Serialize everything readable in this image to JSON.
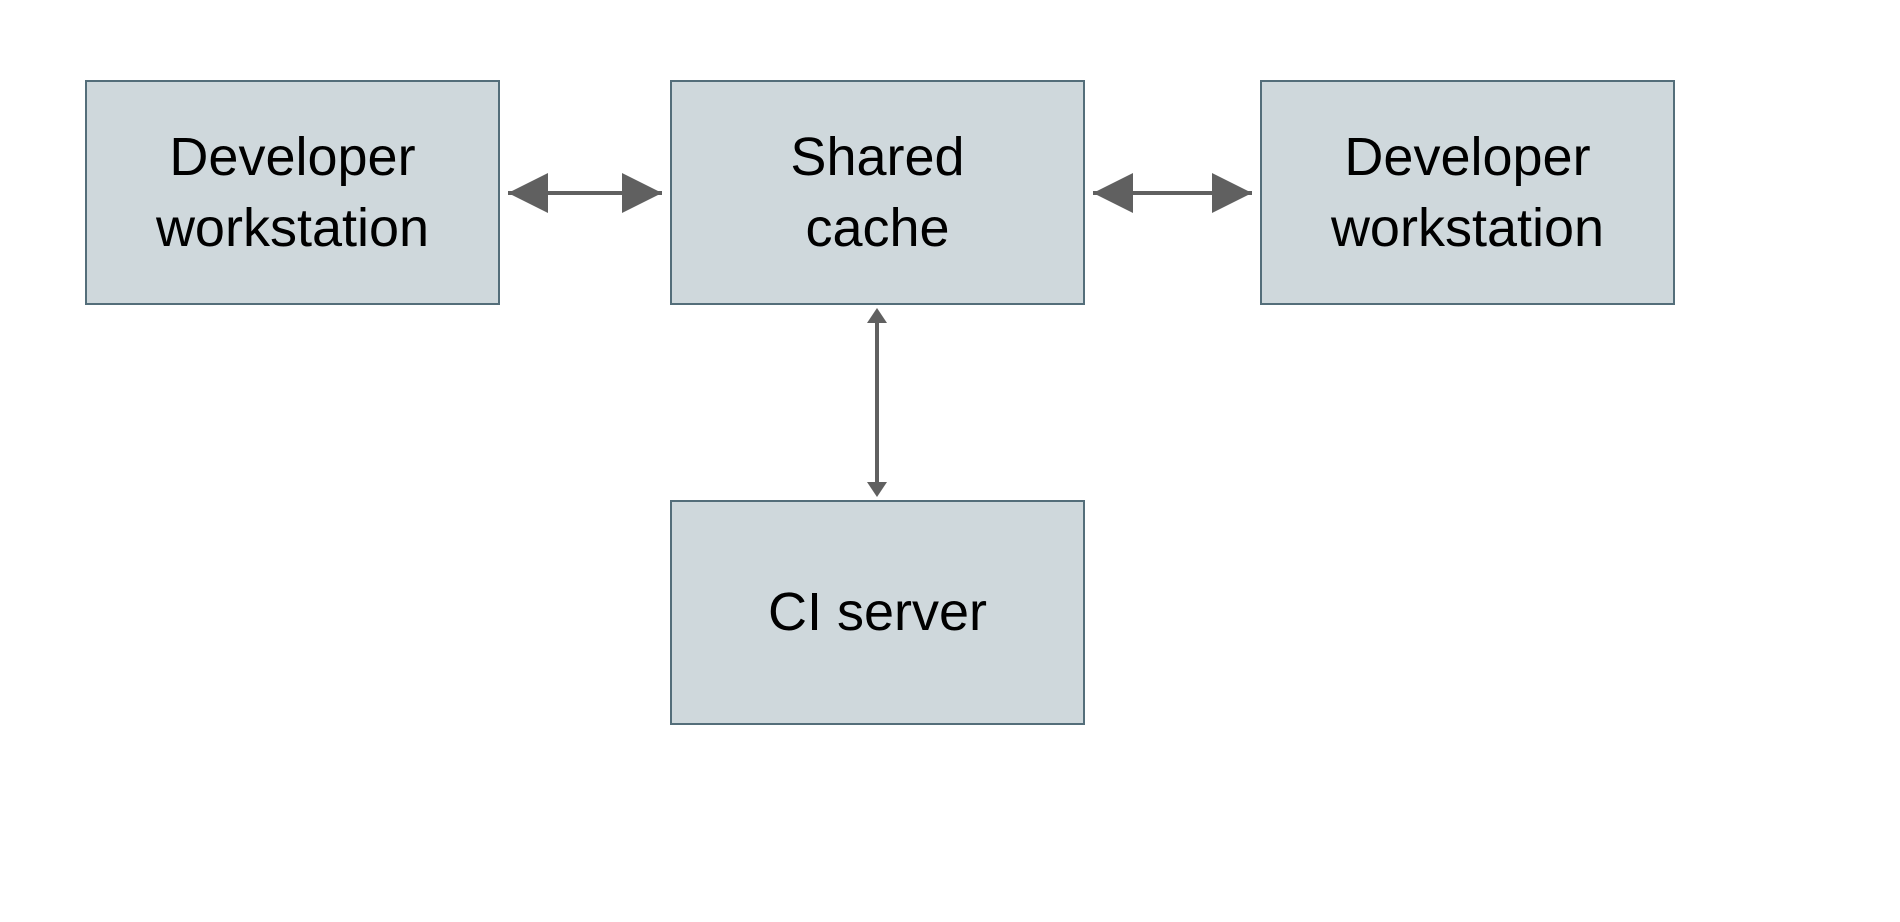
{
  "nodes": {
    "dev_left": {
      "line1": "Developer",
      "line2": "workstation"
    },
    "shared_cache": {
      "line1": "Shared",
      "line2": "cache"
    },
    "dev_right": {
      "line1": "Developer",
      "line2": "workstation"
    },
    "ci_server": {
      "label": "CI server"
    }
  },
  "colors": {
    "box_fill": "#cfd8dc",
    "box_border": "#546e7a",
    "arrow": "#606060"
  }
}
